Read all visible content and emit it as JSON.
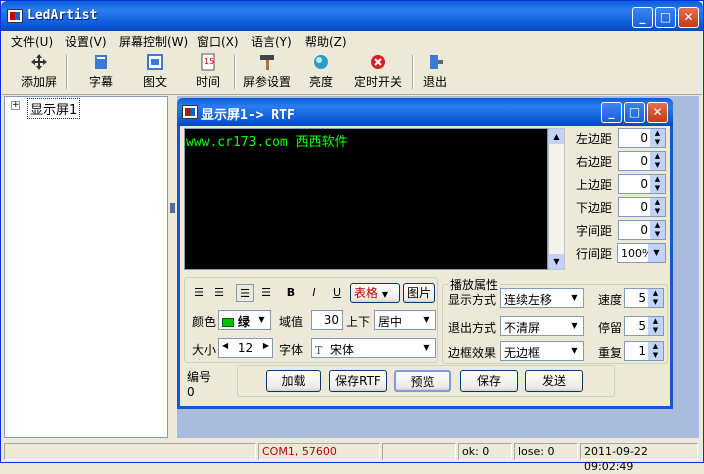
{
  "app": {
    "title": "LedArtist"
  },
  "menu": [
    "文件(U)",
    "设置(V)",
    "屏幕控制(W)",
    "窗口(X)",
    "语言(Y)",
    "帮助(Z)"
  ],
  "toolbar": {
    "items": [
      {
        "label": "添加屏",
        "icon": "add-screen-icon"
      },
      {
        "label": "字幕",
        "icon": "subtitle-icon"
      },
      {
        "label": "图文",
        "icon": "image-text-icon"
      },
      {
        "label": "时间",
        "icon": "clock-icon"
      },
      {
        "label": "屏参设置",
        "icon": "hammer-icon"
      },
      {
        "label": "亮度",
        "icon": "brightness-icon"
      },
      {
        "label": "定时开关",
        "icon": "timer-switch-icon"
      },
      {
        "label": "退出",
        "icon": "exit-icon"
      }
    ]
  },
  "tree": {
    "node": "显示屏1",
    "expander": "+"
  },
  "child": {
    "title": "显示屏1-> RTF",
    "screen_text": "www.cr173.com  西西软件",
    "margins": [
      {
        "label": "左边距",
        "value": "0"
      },
      {
        "label": "右边距",
        "value": "0"
      },
      {
        "label": "上边距",
        "value": "0"
      },
      {
        "label": "下边距",
        "value": "0"
      },
      {
        "label": "字间距",
        "value": "0"
      }
    ],
    "line_spacing": {
      "label": "行间距",
      "value": "100%"
    },
    "format": {
      "bold": "B",
      "italic": "I",
      "underline": "U",
      "table_label": "表格",
      "image_label": "图片"
    },
    "color": {
      "label": "颜色",
      "value": "绿",
      "swatch": "#00c000"
    },
    "threshold": {
      "label": "域值",
      "value": "30"
    },
    "vertical": {
      "label": "上下",
      "value": "居中"
    },
    "size": {
      "label": "大小",
      "value": "12"
    },
    "font": {
      "label": "字体",
      "value": "宋体"
    },
    "play": {
      "title": "播放属性",
      "display_mode": {
        "label": "显示方式",
        "value": "连续左移"
      },
      "exit_mode": {
        "label": "退出方式",
        "value": "不清屏"
      },
      "border": {
        "label": "边框效果",
        "value": "无边框"
      },
      "speed": {
        "label": "速度",
        "value": "5"
      },
      "stay": {
        "label": "停留",
        "value": "5"
      },
      "repeat": {
        "label": "重复",
        "value": "1"
      }
    },
    "number": {
      "label": "编号",
      "value": "0"
    },
    "buttons": {
      "load": "加载",
      "save_rtf": "保存RTF",
      "preview": "预览",
      "save": "保存",
      "send": "发送"
    }
  },
  "status": {
    "port": "COM1, 57600",
    "ok": "ok: 0",
    "lose": "lose: 0",
    "datetime": "2011-09-22 09:02:49"
  },
  "colors": {
    "titlebar": "#0c5ad6",
    "port_text": "#c00000",
    "screen_text": "#00ff00",
    "table_text": "#c00000"
  }
}
